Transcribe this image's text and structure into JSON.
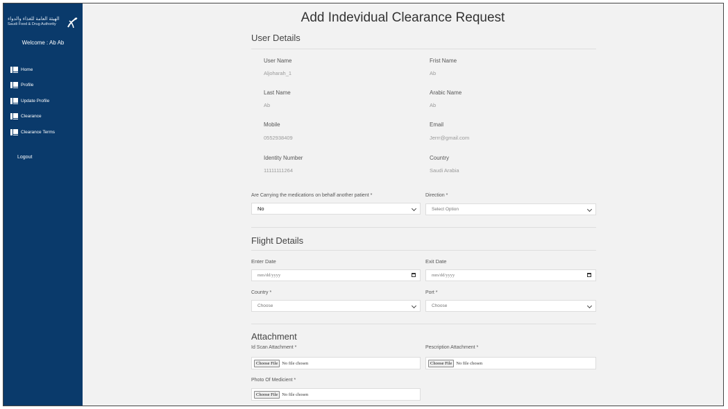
{
  "sidebar": {
    "logo_ar": "الهيئة العامة للغذاء والدواء",
    "logo_en": "Saudi Food & Drug Authority",
    "welcome": "Welcome : Ab Ab",
    "items": [
      {
        "label": "Home"
      },
      {
        "label": "Profile"
      },
      {
        "label": "Update Profile"
      },
      {
        "label": "Clearance"
      },
      {
        "label": "Clearance Terms"
      }
    ],
    "logout": "Logout"
  },
  "page": {
    "title": "Add Indevidual Clearance Request"
  },
  "user_details": {
    "title": "User Details",
    "user_name_label": "User Name",
    "user_name": "Aljoharah_1",
    "first_name_label": "Frist Name",
    "first_name": "Ab",
    "last_name_label": "Last Name",
    "last_name": "Ab",
    "arabic_name_label": "Arabic Name",
    "arabic_name": "Ab",
    "mobile_label": "Mobile",
    "mobile": "0552938409",
    "email_label": "Email",
    "email": "Jerrr@gmail.com",
    "identity_label": "Identity Number",
    "identity": "11111111264",
    "country_label": "Country",
    "country": "Saudi Arabia"
  },
  "carrying": {
    "label": "Are Carrying the medications on behalf another patient *",
    "value": "No",
    "direction_label": "Direction *",
    "direction_value": "Select Option"
  },
  "flight_details": {
    "title": "Flight Details",
    "enter_date_label": "Enter Date",
    "enter_date_placeholder": "mm/dd/yyyy",
    "exit_date_label": "Exit Date",
    "exit_date_placeholder": "mm/dd/yyyy",
    "country_label": "Country *",
    "country_value": "Choose",
    "port_label": "Port *",
    "port_value": "Choose"
  },
  "attachment": {
    "title": "Attachment",
    "id_scan_label": "Id Scan Attachment *",
    "prescription_label": "Pescription Attachment *",
    "photo_label": "Photo Of Medicient *",
    "choose_file": "Choose File",
    "no_file": "No file chosen"
  }
}
